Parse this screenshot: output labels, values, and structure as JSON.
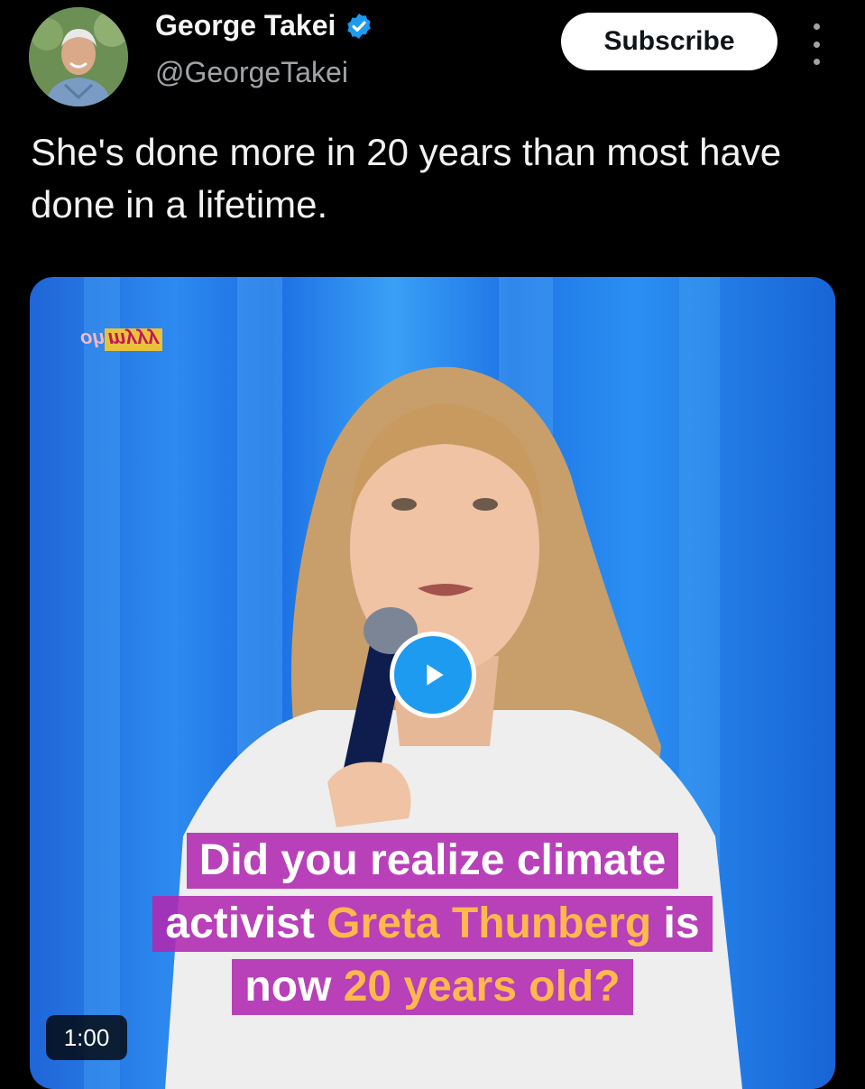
{
  "author": {
    "name": "George Takei",
    "handle": "@GeorgeTakei",
    "verified_icon": "verified-badge-icon"
  },
  "actions": {
    "subscribe_label": "Subscribe",
    "more_icon": "more-options-icon"
  },
  "tweet": {
    "text": "She's done more in 20 years than most have done in a lifetime."
  },
  "media": {
    "watermark_a": "oh",
    "watermark_b": "myyy",
    "caption_line1": "Did you realize climate",
    "caption_line2_a": "activist ",
    "caption_line2_b": "Greta Thunberg",
    "caption_line2_c": " is",
    "caption_line3_a": "now ",
    "caption_line3_b": "20 years old?",
    "duration": "1:00",
    "play_icon": "play-icon",
    "colors": {
      "accent": "#1d9bf0",
      "caption_bg": "#b028b0",
      "highlight": "#ffb84d"
    }
  }
}
